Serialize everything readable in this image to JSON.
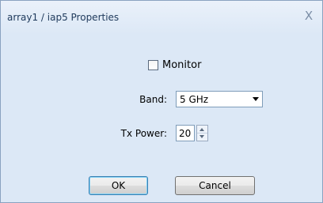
{
  "window": {
    "title": "array1 / iap5 Properties",
    "close_glyph": "X"
  },
  "form": {
    "monitor": {
      "label": "Monitor",
      "checked": false
    },
    "band": {
      "label": "Band:",
      "value": "5 GHz"
    },
    "tx_power": {
      "label": "Tx Power:",
      "value": "20"
    }
  },
  "buttons": {
    "ok_label": "OK",
    "cancel_label": "Cancel"
  },
  "colors": {
    "dialog_background": "#dce8f6",
    "title_text": "#1e395b"
  }
}
